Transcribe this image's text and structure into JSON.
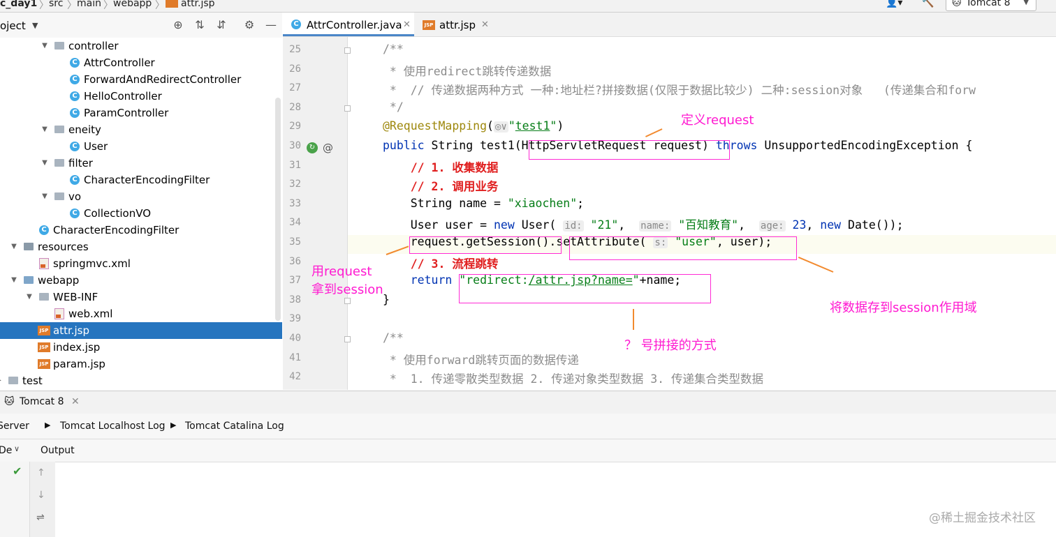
{
  "breadcrumb": {
    "project": "c_day1",
    "path": [
      "src",
      "main",
      "webapp"
    ],
    "file": "attr.jsp"
  },
  "run_config": "Tomcat 8",
  "project_panel": {
    "title": "oject"
  },
  "tree": [
    {
      "label": "controller",
      "kind": "folder",
      "indent": 2,
      "expanded": true
    },
    {
      "label": "AttrController",
      "kind": "class",
      "indent": 3
    },
    {
      "label": "ForwardAndRedirectController",
      "kind": "class",
      "indent": 3
    },
    {
      "label": "HelloController",
      "kind": "class",
      "indent": 3
    },
    {
      "label": "ParamController",
      "kind": "class",
      "indent": 3
    },
    {
      "label": "eneity",
      "kind": "folder",
      "indent": 2,
      "expanded": true
    },
    {
      "label": "User",
      "kind": "class",
      "indent": 3
    },
    {
      "label": "filter",
      "kind": "folder",
      "indent": 2,
      "expanded": true
    },
    {
      "label": "CharacterEncodingFilter",
      "kind": "class",
      "indent": 3
    },
    {
      "label": "vo",
      "kind": "folder",
      "indent": 2,
      "expanded": true
    },
    {
      "label": "CollectionVO",
      "kind": "class",
      "indent": 3
    },
    {
      "label": "CharacterEncodingFilter",
      "kind": "class",
      "indent": 1
    },
    {
      "label": "resources",
      "kind": "resfolder",
      "indent": 0,
      "expanded": true
    },
    {
      "label": "springmvc.xml",
      "kind": "xml",
      "indent": 1
    },
    {
      "label": "webapp",
      "kind": "webfolder",
      "indent": 0,
      "expanded": true
    },
    {
      "label": "WEB-INF",
      "kind": "folder",
      "indent": 1,
      "expanded": true
    },
    {
      "label": "web.xml",
      "kind": "xml",
      "indent": 2
    },
    {
      "label": "attr.jsp",
      "kind": "jsp",
      "indent": 1,
      "selected": true
    },
    {
      "label": "index.jsp",
      "kind": "jsp",
      "indent": 1
    },
    {
      "label": "param.jsp",
      "kind": "jsp",
      "indent": 1
    },
    {
      "label": "test",
      "kind": "folder",
      "indent": -1,
      "expanded": false
    }
  ],
  "tabs": [
    {
      "label": "AttrController.java",
      "active": true
    },
    {
      "label": "attr.jsp",
      "active": false
    }
  ],
  "code_lines": [
    {
      "n": "25",
      "html": "<span class=\"cm\">/**</span>"
    },
    {
      "n": "26",
      "html": "<span class=\"cm\"> * 使用redirect跳转传递数据</span>"
    },
    {
      "n": "27",
      "html": "<span class=\"cm\"> *  // 传递数据两种方式 一种:地址栏?拼接数据(仅限于数据比较少) 二种:session对象   (传递集合和forw</span>"
    },
    {
      "n": "28",
      "html": "<span class=\"cm\"> */</span>"
    },
    {
      "n": "29",
      "html": "<span class=\"ann\">@RequestMapping</span>(<span class=\"hint\">◎∨</span><span class=\"str\">\"<u>test1</u>\"</span>)"
    },
    {
      "n": "30",
      "html": "<span class=\"kw\">public</span> String test1(HttpServletRequest request) <span class=\"kw\">throws</span> UnsupportedEncodingException {"
    },
    {
      "n": "31",
      "html": "    <span class=\"red\">// 1. 收集数据</span>"
    },
    {
      "n": "32",
      "html": "    <span class=\"red\">// 2. 调用业务</span>"
    },
    {
      "n": "33",
      "html": "    String name = <span class=\"str\">\"xiaochen\"</span>;"
    },
    {
      "n": "34",
      "html": "    User user = <span class=\"kw\">new</span> User( <span class=\"hint\">id:</span> <span class=\"str\">\"21\"</span>,  <span class=\"hint\">name:</span> <span class=\"str\">\"百知教育\"</span>,  <span class=\"hint\">age:</span> <span class=\"kw\">23</span>, <span class=\"kw\">new</span> Date());"
    },
    {
      "n": "35",
      "html": "    request.getSession().setAttribute( <span class=\"hint\">s:</span> <span class=\"str\">\"user\"</span>, user);"
    },
    {
      "n": "36",
      "html": "    <span class=\"red\">// 3. 流程跳转</span>"
    },
    {
      "n": "37",
      "html": "    <span class=\"kw\">return</span> <span class=\"str\">\"redirect:<u>/attr.jsp?name=</u>\"</span>+name;"
    },
    {
      "n": "38",
      "html": "}"
    },
    {
      "n": "39",
      "html": ""
    },
    {
      "n": "40",
      "html": "<span class=\"cm\">/**</span>"
    },
    {
      "n": "41",
      "html": "<span class=\"cm\"> * 使用forward跳转页面的数据传递</span>"
    },
    {
      "n": "42",
      "html": "<span class=\"cm\"> *  1. 传递零散类型数据 2. 传递对象类型数据 3. 传递集合类型数据</span>"
    }
  ],
  "annotations": {
    "define_request": "定义request",
    "use_request_1": "用request",
    "use_request_2": "拿到session",
    "store_session": "将数据存到session作用域",
    "question_concat": "？ 号拼接的方式"
  },
  "bottom": {
    "run_tab": "Tomcat 8",
    "server_tab": "Server",
    "localhost_log": "Tomcat Localhost Log",
    "catalina_log": "Tomcat Catalina Log",
    "deploy_label": "De",
    "output_label": "Output"
  },
  "watermark": "@稀土掘金技术社区",
  "colors": {
    "annotation": "#ff1ad1",
    "arrow": "#f28a2e",
    "selection": "#2675bf"
  }
}
